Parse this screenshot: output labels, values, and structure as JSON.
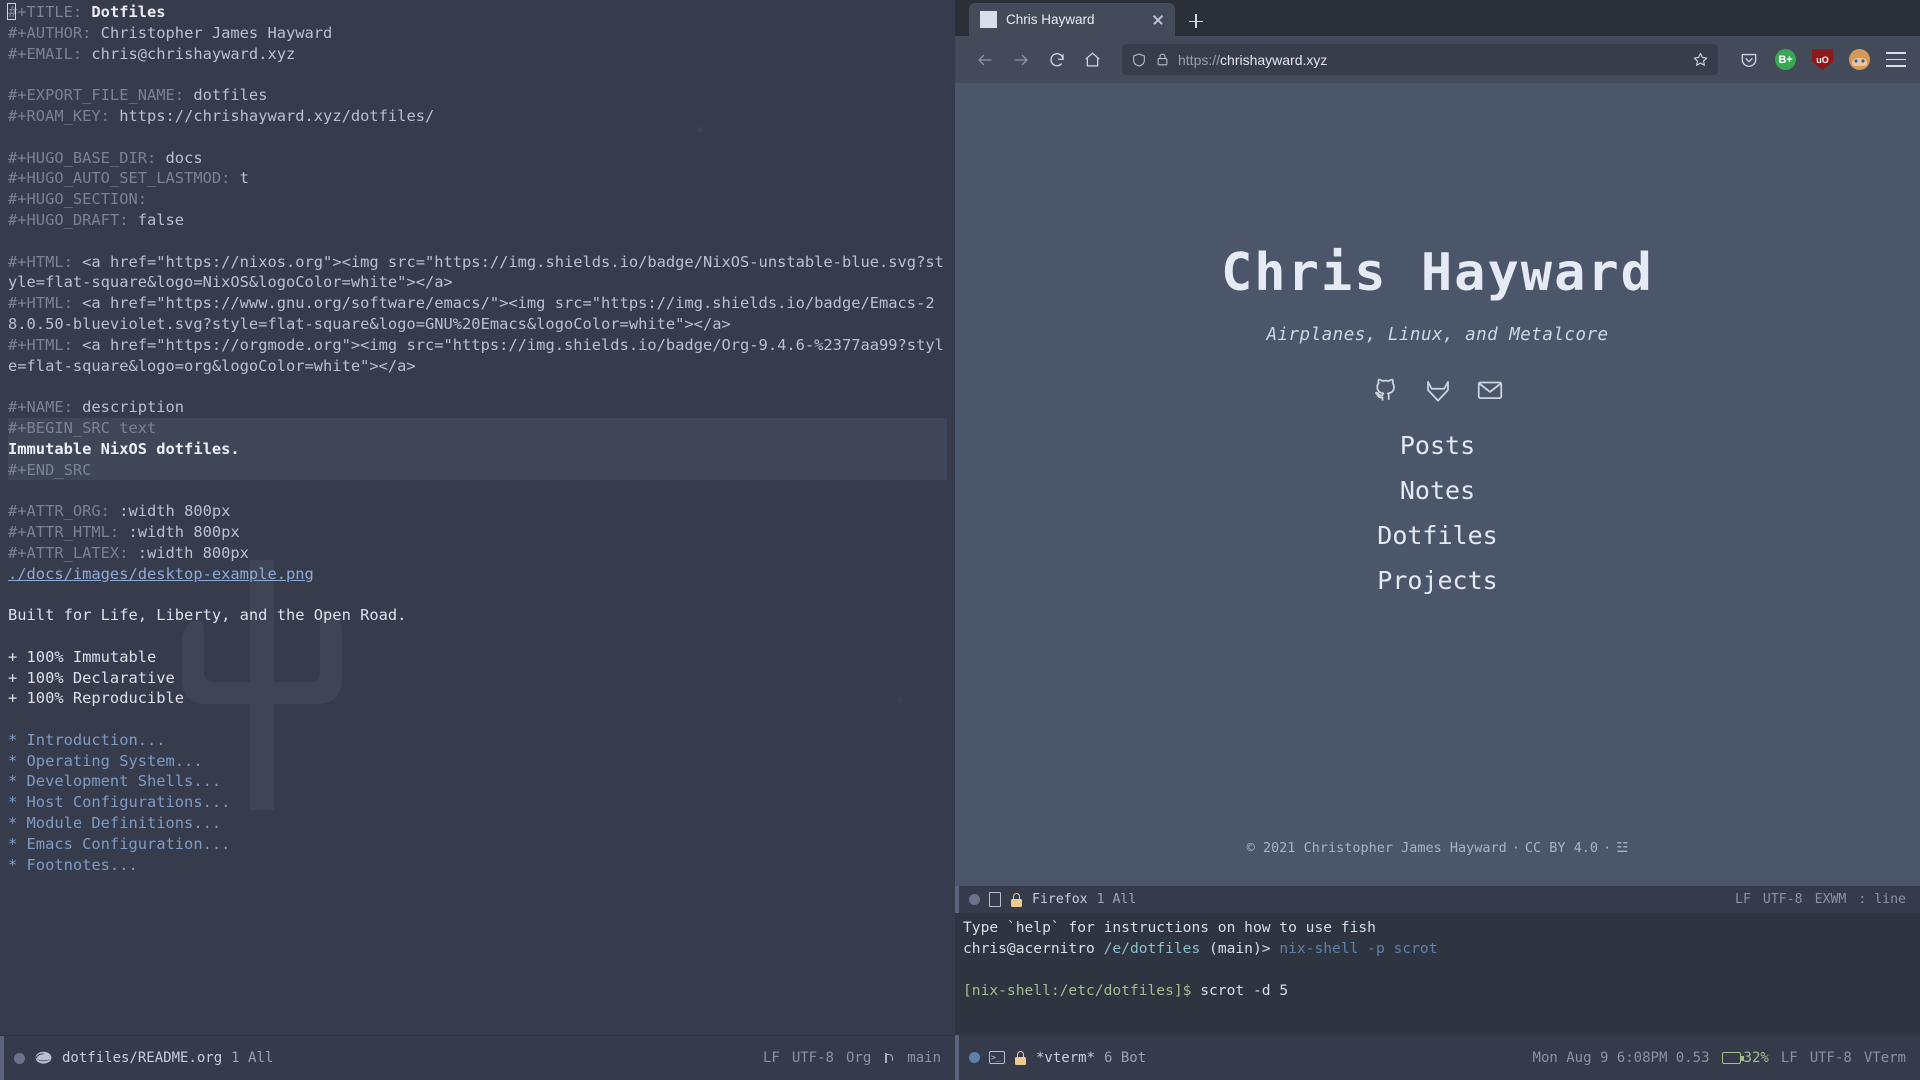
{
  "emacs": {
    "org_lines": [
      {
        "t": "meta-title",
        "parts": [
          {
            "c": "kw",
            "s": "#+TITLE:"
          },
          {
            "c": "bold-val",
            "s": " Dotfiles"
          }
        ],
        "cursor": true
      },
      {
        "t": "meta",
        "parts": [
          {
            "c": "kw",
            "s": "#+AUTHOR:"
          },
          {
            "c": "val",
            "s": " Christopher James Hayward"
          }
        ]
      },
      {
        "t": "meta",
        "parts": [
          {
            "c": "kw",
            "s": "#+EMAIL:"
          },
          {
            "c": "val",
            "s": " chris@chrishayward.xyz"
          }
        ]
      },
      {
        "t": "blank",
        "parts": []
      },
      {
        "t": "meta",
        "parts": [
          {
            "c": "kw",
            "s": "#+EXPORT_FILE_NAME:"
          },
          {
            "c": "val",
            "s": " dotfiles"
          }
        ]
      },
      {
        "t": "meta",
        "parts": [
          {
            "c": "kw",
            "s": "#+ROAM_KEY:"
          },
          {
            "c": "val",
            "s": " https://chrishayward.xyz/dotfiles/"
          }
        ]
      },
      {
        "t": "blank",
        "parts": []
      },
      {
        "t": "meta",
        "parts": [
          {
            "c": "kw",
            "s": "#+HUGO_BASE_DIR:"
          },
          {
            "c": "val",
            "s": " docs"
          }
        ]
      },
      {
        "t": "meta",
        "parts": [
          {
            "c": "kw",
            "s": "#+HUGO_AUTO_SET_LASTMOD:"
          },
          {
            "c": "val",
            "s": " t"
          }
        ]
      },
      {
        "t": "meta",
        "parts": [
          {
            "c": "kw",
            "s": "#+HUGO_SECTION:"
          }
        ]
      },
      {
        "t": "meta",
        "parts": [
          {
            "c": "kw",
            "s": "#+HUGO_DRAFT:"
          },
          {
            "c": "val",
            "s": " false"
          }
        ]
      },
      {
        "t": "blank",
        "parts": []
      },
      {
        "t": "meta",
        "parts": [
          {
            "c": "kw",
            "s": "#+HTML:"
          },
          {
            "c": "val",
            "s": " <a href=\"https://nixos.org\"><img src=\"https://img.shields.io/badge/NixOS-unstable-blue.svg?style=flat-square&logo=NixOS&logoColor=white\"></a>"
          }
        ]
      },
      {
        "t": "meta",
        "parts": [
          {
            "c": "kw",
            "s": "#+HTML:"
          },
          {
            "c": "val",
            "s": " <a href=\"https://www.gnu.org/software/emacs/\"><img src=\"https://img.shields.io/badge/Emacs-28.0.50-blueviolet.svg?style=flat-square&logo=GNU%20Emacs&logoColor=white\"></a>"
          }
        ]
      },
      {
        "t": "meta",
        "parts": [
          {
            "c": "kw",
            "s": "#+HTML:"
          },
          {
            "c": "val",
            "s": " <a href=\"https://orgmode.org\"><img src=\"https://img.shields.io/badge/Org-9.4.6-%2377aa99?style=flat-square&logo=org&logoColor=white\"></a>"
          }
        ]
      },
      {
        "t": "blank",
        "parts": []
      },
      {
        "t": "meta",
        "parts": [
          {
            "c": "kw",
            "s": "#+NAME:"
          },
          {
            "c": "val",
            "s": " description"
          }
        ]
      },
      {
        "t": "src-begin",
        "parts": [
          {
            "c": "kw",
            "s": "#+BEGIN_SRC text"
          }
        ]
      },
      {
        "t": "src-body",
        "parts": [
          {
            "c": "srcbody",
            "s": "Immutable NixOS dotfiles."
          }
        ]
      },
      {
        "t": "src-end",
        "parts": [
          {
            "c": "kw",
            "s": "#+END_SRC"
          }
        ]
      },
      {
        "t": "blank",
        "parts": []
      },
      {
        "t": "meta",
        "parts": [
          {
            "c": "kw",
            "s": "#+ATTR_ORG:"
          },
          {
            "c": "val",
            "s": " :width 800px"
          }
        ]
      },
      {
        "t": "meta",
        "parts": [
          {
            "c": "kw",
            "s": "#+ATTR_HTML:"
          },
          {
            "c": "val",
            "s": " :width 800px"
          }
        ]
      },
      {
        "t": "meta",
        "parts": [
          {
            "c": "kw",
            "s": "#+ATTR_LATEX:"
          },
          {
            "c": "val",
            "s": " :width 800px"
          }
        ]
      },
      {
        "t": "link",
        "parts": [
          {
            "c": "orglink",
            "s": "./docs/images/desktop-example.png"
          }
        ]
      },
      {
        "t": "blank",
        "parts": []
      },
      {
        "t": "text",
        "parts": [
          {
            "c": "plain",
            "s": "Built for Life, Liberty, and the Open Road."
          }
        ]
      },
      {
        "t": "blank",
        "parts": []
      },
      {
        "t": "text",
        "parts": [
          {
            "c": "plain",
            "s": "+ 100% Immutable"
          }
        ]
      },
      {
        "t": "text",
        "parts": [
          {
            "c": "plain",
            "s": "+ 100% Declarative"
          }
        ]
      },
      {
        "t": "text",
        "parts": [
          {
            "c": "plain",
            "s": "+ 100% Reproducible"
          }
        ]
      },
      {
        "t": "blank",
        "parts": []
      },
      {
        "t": "heading",
        "parts": [
          {
            "c": "h1",
            "s": "* Introduction..."
          }
        ]
      },
      {
        "t": "heading",
        "parts": [
          {
            "c": "h1",
            "s": "* Operating System..."
          }
        ]
      },
      {
        "t": "heading",
        "parts": [
          {
            "c": "h1",
            "s": "* Development Shells..."
          }
        ]
      },
      {
        "t": "heading",
        "parts": [
          {
            "c": "h1",
            "s": "* Host Configurations..."
          }
        ]
      },
      {
        "t": "heading",
        "parts": [
          {
            "c": "h1",
            "s": "* Module Definitions..."
          }
        ]
      },
      {
        "t": "heading",
        "parts": [
          {
            "c": "h1",
            "s": "* Emacs Configuration..."
          }
        ]
      },
      {
        "t": "heading",
        "parts": [
          {
            "c": "h1",
            "s": "* Footnotes..."
          }
        ]
      }
    ],
    "modeline": {
      "buffer": "dotfiles/README.org",
      "position": "1 All",
      "eol": "LF",
      "encoding": "UTF-8",
      "major_mode": "Org",
      "branch": "main"
    }
  },
  "firefox": {
    "tab": {
      "title": "Chris Hayward"
    },
    "urlbar": {
      "scheme": "https://",
      "host": "chrishayward.xyz"
    },
    "extensions": {
      "bitwarden_label": "B+",
      "ublock_label": "uO"
    }
  },
  "website": {
    "title": "Chris Hayward",
    "subtitle": "Airplanes, Linux, and Metalcore",
    "social": [
      {
        "name": "github",
        "label": "GitHub"
      },
      {
        "name": "gitlab",
        "label": "GitLab"
      },
      {
        "name": "email",
        "label": "Email"
      }
    ],
    "nav": [
      {
        "label": "Posts"
      },
      {
        "label": "Notes"
      },
      {
        "label": "Dotfiles"
      },
      {
        "label": "Projects"
      }
    ],
    "footer": {
      "copyright": "© 2021 Christopher James Hayward",
      "sep1": "·",
      "license": "CC BY 4.0",
      "sep2": "·",
      "feed": "☳"
    }
  },
  "ff_modeline": {
    "buffer": "Firefox",
    "position": "1 All",
    "eol": "LF",
    "encoding": "UTF-8",
    "major_mode": "EXWM",
    "extra": ": line"
  },
  "vterm": {
    "lines": [
      {
        "segments": [
          {
            "c": "",
            "s": "Type `help` for instructions on how to use fish"
          }
        ]
      },
      {
        "segments": [
          {
            "c": "",
            "s": "chris@acernitro "
          },
          {
            "c": "term-path",
            "s": "/e/dotfiles"
          },
          {
            "c": "",
            "s": " (main)> "
          },
          {
            "c": "term-cmd",
            "s": "nix-shell -p scrot"
          }
        ]
      },
      {
        "segments": []
      },
      {
        "segments": [
          {
            "c": "term-nix",
            "s": "[nix-shell:/etc/dotfiles]$"
          },
          {
            "c": "",
            "s": " scrot -d 5"
          }
        ]
      }
    ],
    "modeline": {
      "buffer": "*vterm*",
      "position": "6 Bot",
      "date": "Mon Aug  9 6:08PM 0.53",
      "battery": "32%",
      "eol": "LF",
      "encoding": "UTF-8",
      "major_mode": "VTerm"
    }
  }
}
